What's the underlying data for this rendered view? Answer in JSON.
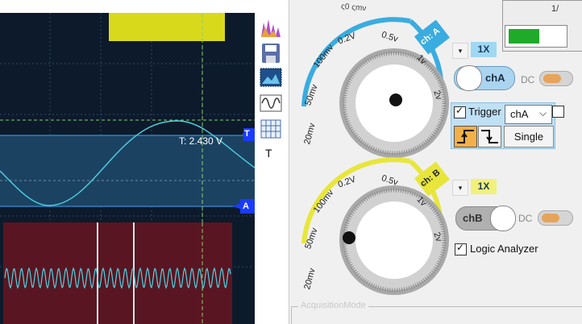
{
  "scope": {
    "trace_a_label": "T: 2.430 V",
    "marker_t": "T",
    "marker_a": "A"
  },
  "toolbar": {
    "text_tool": "T"
  },
  "panel": {
    "top_partial": "1/",
    "channel_a": {
      "tag": "ch: A",
      "knob_labels": [
        "20mv",
        "50mv",
        "100mv",
        "0.2V",
        "0.5v",
        "1v",
        "2v"
      ],
      "top_partial": "ς0 ςmν",
      "dropdown_glyph": "▾",
      "gain": "1X",
      "toggle_label": "chA",
      "coupling": "DC"
    },
    "trigger": {
      "label": "Trigger",
      "source_value": "chA",
      "source_arrow": "⌵",
      "single_label": "Single"
    },
    "channel_b": {
      "tag": "ch: B",
      "knob_labels": [
        "20mv",
        "50mv",
        "100mv",
        "0.2V",
        "0.5v",
        "1v",
        "2v"
      ],
      "dropdown_glyph": "▾",
      "gain": "1X",
      "toggle_label": "chB",
      "coupling": "DC"
    },
    "logic_analyzer": {
      "label": "Logic Analyzer"
    },
    "acquisition_mode": {
      "label": "AcquisitionMode"
    }
  },
  "colors": {
    "scope_bg": "#0d1a2b",
    "band_blue": "#1c4262",
    "trace_cyan": "#4cd3e0",
    "yellow_ref": "#d9d91c",
    "logic_bg": "#5a1522",
    "ch_a_accent": "#3aace0",
    "ch_b_accent": "#e8e63c",
    "toggle_a": "#aad4ef",
    "toggle_b": "#b0b0b0",
    "trigger_box": "#bfe0f5"
  }
}
